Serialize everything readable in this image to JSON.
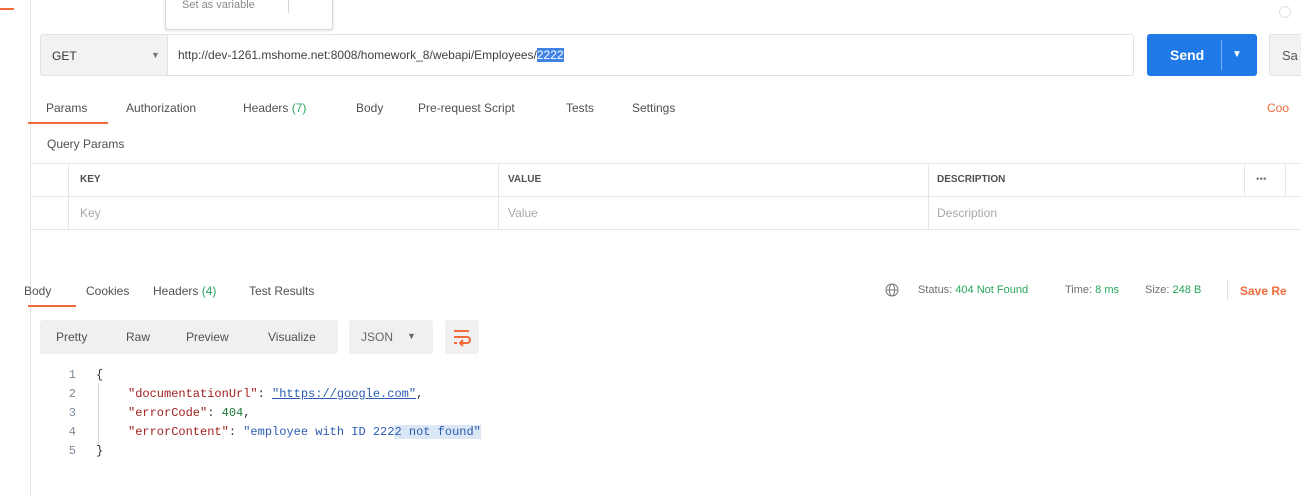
{
  "tooltip": {
    "text": "Set as variable"
  },
  "request": {
    "method": "GET",
    "url_prefix": "http://dev-1261.mshome.net:8008/homework_8/webapi/Employees/",
    "url_selected": "2222",
    "send_label": "Send",
    "save_label": "Sa"
  },
  "request_tabs": [
    {
      "label": "Params",
      "count": ""
    },
    {
      "label": "Authorization",
      "count": ""
    },
    {
      "label": "Headers",
      "count": "(7)"
    },
    {
      "label": "Body",
      "count": ""
    },
    {
      "label": "Pre-request Script",
      "count": ""
    },
    {
      "label": "Tests",
      "count": ""
    },
    {
      "label": "Settings",
      "count": ""
    }
  ],
  "cookies_link": "Coo",
  "query_params": {
    "title": "Query Params",
    "columns": [
      "KEY",
      "VALUE",
      "DESCRIPTION"
    ],
    "placeholders": [
      "Key",
      "Value",
      "Description"
    ],
    "more": "•••"
  },
  "response_tabs": [
    {
      "label": "Body",
      "count": ""
    },
    {
      "label": "Cookies",
      "count": ""
    },
    {
      "label": "Headers",
      "count": "(4)"
    },
    {
      "label": "Test Results",
      "count": ""
    }
  ],
  "status": {
    "status_label": "Status:",
    "status_value": "404 Not Found",
    "time_label": "Time:",
    "time_value": "8 ms",
    "size_label": "Size:",
    "size_value": "248 B",
    "save_response": "Save Re"
  },
  "format_buttons": [
    "Pretty",
    "Raw",
    "Preview",
    "Visualize"
  ],
  "format_select": "JSON",
  "code": {
    "line_numbers": [
      "1",
      "2",
      "3",
      "4",
      "5"
    ],
    "open_brace": "{",
    "close_brace": "}",
    "k1": "\"documentationUrl\"",
    "v1": "\"https://google.com\"",
    "k2": "\"errorCode\"",
    "v2": "404",
    "k3": "\"errorContent\"",
    "v3_plain": "\"employee with ID 222",
    "v3_selected": "2 not found\""
  },
  "colors": {
    "accent": "#f26b3a",
    "primary": "#1f7ae8",
    "success": "#26a65b"
  }
}
